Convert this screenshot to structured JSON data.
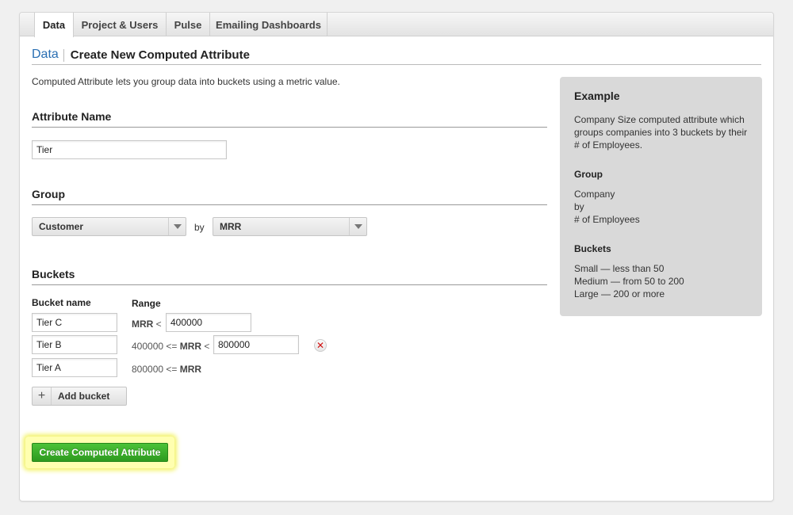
{
  "tabs": [
    {
      "label": "Data",
      "active": true
    },
    {
      "label": "Project & Users",
      "active": false
    },
    {
      "label": "Pulse",
      "active": false
    },
    {
      "label": "Emailing Dashboards",
      "active": false
    }
  ],
  "breadcrumb": {
    "parent": "Data",
    "current": "Create New Computed Attribute"
  },
  "intro": "Computed Attribute lets you group data into buckets using a metric value.",
  "attribute_name": {
    "heading": "Attribute Name",
    "value": "Tier"
  },
  "group": {
    "heading": "Group",
    "entity": "Customer",
    "by_label": "by",
    "metric": "MRR"
  },
  "buckets": {
    "heading": "Buckets",
    "col_name": "Bucket name",
    "col_range": "Range",
    "rows": [
      {
        "name": "Tier C",
        "prefix": "",
        "metric": "MRR",
        "op": "<",
        "upper": "400000"
      },
      {
        "name": "Tier B",
        "prefix": "400000 <=",
        "metric": "MRR",
        "op": "<",
        "upper": "800000",
        "remove": "✕"
      },
      {
        "name": "Tier A",
        "prefix": "800000 <=",
        "metric": "MRR",
        "op": "",
        "upper": ""
      }
    ],
    "add_icon": "+",
    "add_label": "Add bucket"
  },
  "submit_label": "Create Computed Attribute",
  "example": {
    "title": "Example",
    "description": "Company Size computed attribute which groups companies into 3 buckets by their # of Employees.",
    "group_heading": "Group",
    "group_lines": [
      "Company",
      "by",
      "# of Employees"
    ],
    "buckets_heading": "Buckets",
    "bucket_lines": [
      "Small — less than 50",
      "Medium — from 50 to 200",
      "Large — 200 or more"
    ]
  },
  "colors": {
    "link": "#2a6fb3",
    "submit_green": "#36a826",
    "highlight": "#f3f36a",
    "remove_red": "#d01010"
  }
}
